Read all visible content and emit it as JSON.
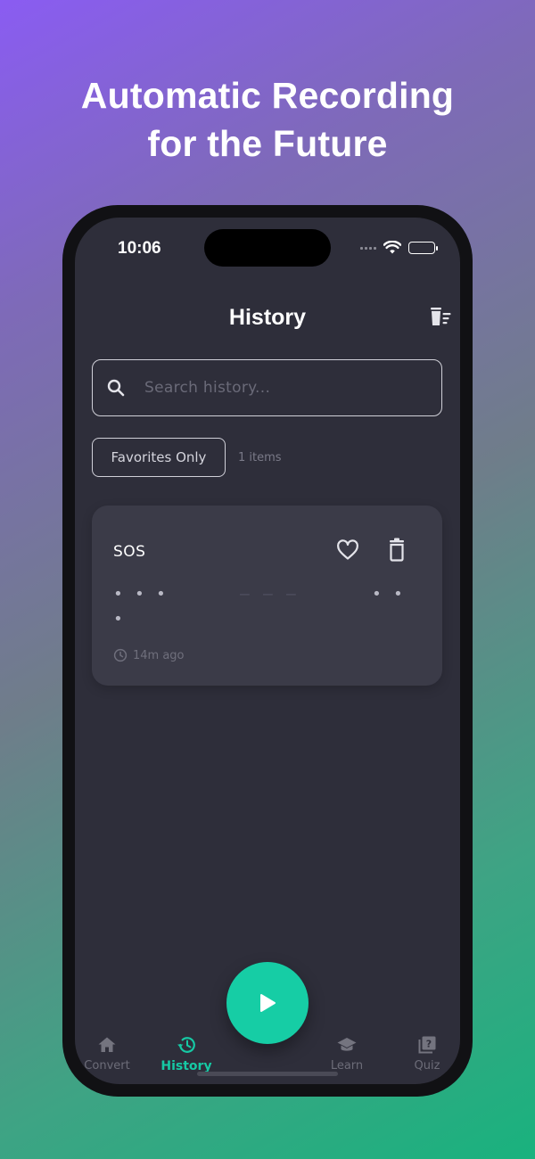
{
  "headline": {
    "line1": "Automatic Recording",
    "line2": "for the Future"
  },
  "status_bar": {
    "time": "10:06"
  },
  "header": {
    "title": "History",
    "clear_icon": "trash-list-icon"
  },
  "search": {
    "placeholder": "Search history...",
    "value": "",
    "icon": "search-icon"
  },
  "filter": {
    "favorites_label": "Favorites Only",
    "count_text": "1 items"
  },
  "history": {
    "items": [
      {
        "title": "SOS",
        "morse": "... --- ...",
        "time_ago": "14m ago",
        "favorite": false
      }
    ]
  },
  "tabs": [
    {
      "label": "Convert",
      "icon": "home-icon",
      "active": false
    },
    {
      "label": "History",
      "icon": "history-icon",
      "active": true
    },
    {
      "label": "Learn",
      "icon": "graduation-cap-icon",
      "active": false
    },
    {
      "label": "Quiz",
      "icon": "quiz-icon",
      "active": false
    }
  ],
  "fab": {
    "icon": "play-icon"
  },
  "colors": {
    "accent": "#16cda5",
    "background": "#2e2e3a",
    "card": "#3b3b48"
  }
}
